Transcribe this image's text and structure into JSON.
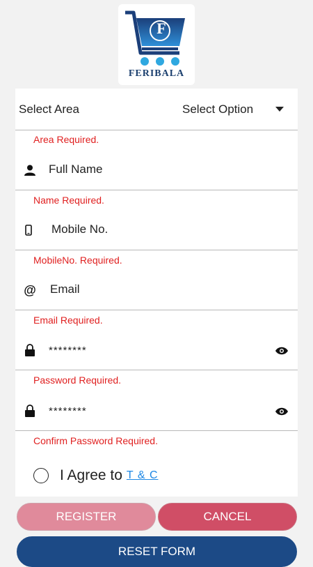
{
  "brand": {
    "name": "FERIBALA",
    "logo_letter": "F"
  },
  "area_select": {
    "label": "Select Area",
    "value": "Select Option"
  },
  "errors": {
    "area": "Area Required.",
    "name": "Name Required.",
    "mobile": "MobileNo. Required.",
    "email": "Email Required.",
    "password": "Password Required.",
    "confirm_password": "Confirm Password Required."
  },
  "fields": {
    "full_name": {
      "placeholder": "Full Name"
    },
    "mobile": {
      "placeholder": "Mobile No."
    },
    "email": {
      "placeholder": "Email"
    },
    "password": {
      "value": "********"
    },
    "confirm_password": {
      "value": "********"
    }
  },
  "agree": {
    "text": "I Agree to",
    "link": "T & C"
  },
  "buttons": {
    "register": "REGISTER",
    "cancel": "CANCEL",
    "reset": "RESET FORM"
  },
  "colors": {
    "brand_blue": "#1c4a86",
    "register": "#e08a9b",
    "cancel": "#d04e66",
    "error": "#e02020",
    "link": "#1e88e5"
  },
  "icons": {
    "name": "person-icon",
    "mobile": "phone-icon",
    "email": "at-icon",
    "password": "lock-icon",
    "visibility": "eye-icon"
  }
}
